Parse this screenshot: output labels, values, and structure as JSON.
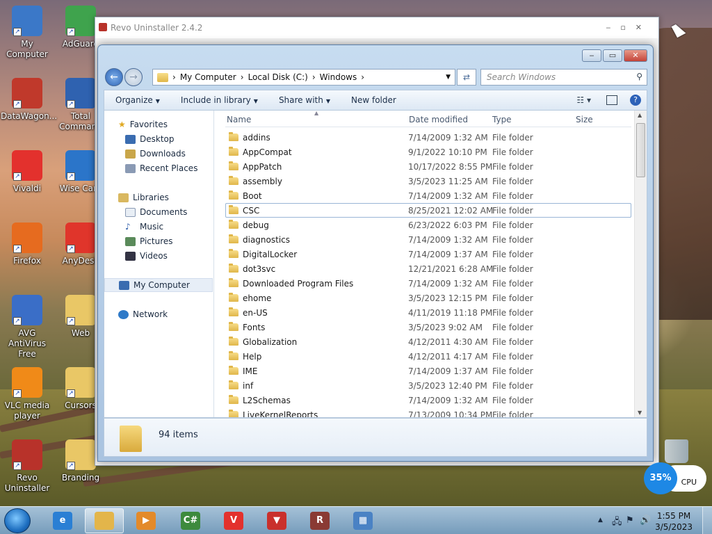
{
  "desktop": {
    "icons": [
      {
        "label": "My Computer",
        "icon": "computer-icon",
        "color": "#3b78c8"
      },
      {
        "label": "AdGuard",
        "icon": "adguard-shield-icon",
        "color": "#3fa34d"
      },
      {
        "label": "DataWagon...",
        "icon": "datawagon-icon",
        "color": "#c0392b"
      },
      {
        "label": "Total Command",
        "icon": "total-commander-icon",
        "color": "#2f62b0"
      },
      {
        "label": "Vivaldi",
        "icon": "vivaldi-icon",
        "color": "#e3312d"
      },
      {
        "label": "Wise Care",
        "icon": "wise-care-icon",
        "color": "#2b75c9"
      },
      {
        "label": "Firefox",
        "icon": "firefox-icon",
        "color": "#e66b1f"
      },
      {
        "label": "AnyDesk",
        "icon": "anydesk-icon",
        "color": "#e0352b"
      },
      {
        "label": "AVG AntiVirus Free",
        "icon": "avg-icon",
        "color": "#3a6ec7"
      },
      {
        "label": "Web",
        "icon": "folder-icon",
        "color": "#e9c766"
      },
      {
        "label": "VLC media player",
        "icon": "vlc-cone-icon",
        "color": "#f08a18"
      },
      {
        "label": "Cursors",
        "icon": "folder-icon",
        "color": "#e9c766"
      },
      {
        "label": "Revo Uninstaller",
        "icon": "revo-uninstaller-icon",
        "color": "#b8322a"
      },
      {
        "label": "Branding",
        "icon": "folder-icon",
        "color": "#e9c766"
      }
    ]
  },
  "revo_window": {
    "title": "Revo Uninstaller 2.4.2"
  },
  "explorer": {
    "breadcrumb": [
      "My Computer",
      "Local Disk (C:)",
      "Windows"
    ],
    "search_placeholder": "Search Windows",
    "toolbar": {
      "organize": "Organize",
      "include_in_library": "Include in library",
      "share_with": "Share with",
      "new_folder": "New folder"
    },
    "nav": {
      "favorites": "Favorites",
      "favorites_items": [
        "Desktop",
        "Downloads",
        "Recent Places"
      ],
      "libraries": "Libraries",
      "libraries_items": [
        "Documents",
        "Music",
        "Pictures",
        "Videos"
      ],
      "my_computer": "My Computer",
      "network": "Network"
    },
    "columns": {
      "name": "Name",
      "date_modified": "Date modified",
      "type": "Type",
      "size": "Size"
    },
    "rows": [
      {
        "name": "addins",
        "date": "7/14/2009 1:32 AM",
        "type": "File folder"
      },
      {
        "name": "AppCompat",
        "date": "9/1/2022 10:10 PM",
        "type": "File folder"
      },
      {
        "name": "AppPatch",
        "date": "10/17/2022 8:55 PM",
        "type": "File folder"
      },
      {
        "name": "assembly",
        "date": "3/5/2023 11:25 AM",
        "type": "File folder"
      },
      {
        "name": "Boot",
        "date": "7/14/2009 1:32 AM",
        "type": "File folder"
      },
      {
        "name": "CSC",
        "date": "8/25/2021 12:02 AM",
        "type": "File folder"
      },
      {
        "name": "debug",
        "date": "6/23/2022 6:03 PM",
        "type": "File folder"
      },
      {
        "name": "diagnostics",
        "date": "7/14/2009 1:32 AM",
        "type": "File folder"
      },
      {
        "name": "DigitalLocker",
        "date": "7/14/2009 1:37 AM",
        "type": "File folder"
      },
      {
        "name": "dot3svc",
        "date": "12/21/2021 6:28 AM",
        "type": "File folder"
      },
      {
        "name": "Downloaded Program Files",
        "date": "7/14/2009 1:32 AM",
        "type": "File folder"
      },
      {
        "name": "ehome",
        "date": "3/5/2023 12:15 PM",
        "type": "File folder"
      },
      {
        "name": "en-US",
        "date": "4/11/2019 11:18 PM",
        "type": "File folder"
      },
      {
        "name": "Fonts",
        "date": "3/5/2023 9:02 AM",
        "type": "File folder"
      },
      {
        "name": "Globalization",
        "date": "4/12/2011 4:30 AM",
        "type": "File folder"
      },
      {
        "name": "Help",
        "date": "4/12/2011 4:17 AM",
        "type": "File folder"
      },
      {
        "name": "IME",
        "date": "7/14/2009 1:37 AM",
        "type": "File folder"
      },
      {
        "name": "inf",
        "date": "3/5/2023 12:40 PM",
        "type": "File folder"
      },
      {
        "name": "L2Schemas",
        "date": "7/14/2009 1:32 AM",
        "type": "File folder"
      },
      {
        "name": "LiveKernelReports",
        "date": "7/13/2009 10:34 PM",
        "type": "File folder"
      }
    ],
    "item_count": "94 items"
  },
  "taskbar": {
    "apps": [
      {
        "icon": "internet-explorer-icon",
        "color": "#2a7fd4",
        "glyph": "e"
      },
      {
        "icon": "windows-explorer-icon",
        "color": "#e3b54a",
        "glyph": "",
        "active": true
      },
      {
        "icon": "media-player-icon",
        "color": "#e38a2a",
        "glyph": "▶"
      },
      {
        "icon": "csharp-editor-icon",
        "color": "#3d8a3d",
        "glyph": "C#"
      },
      {
        "icon": "vivaldi-icon",
        "color": "#e3312d",
        "glyph": "V"
      },
      {
        "icon": "adguard-browser-icon",
        "color": "#c9302c",
        "glyph": "▼"
      },
      {
        "icon": "revo-uninstaller-icon",
        "color": "#8a3a34",
        "glyph": "R"
      },
      {
        "icon": "control-panel-icon",
        "color": "#4a82c4",
        "glyph": "▦"
      }
    ],
    "time": "1:55 PM",
    "date": "3/5/2023"
  },
  "cpu_widget": {
    "percent": "35%",
    "label": "CPU"
  }
}
